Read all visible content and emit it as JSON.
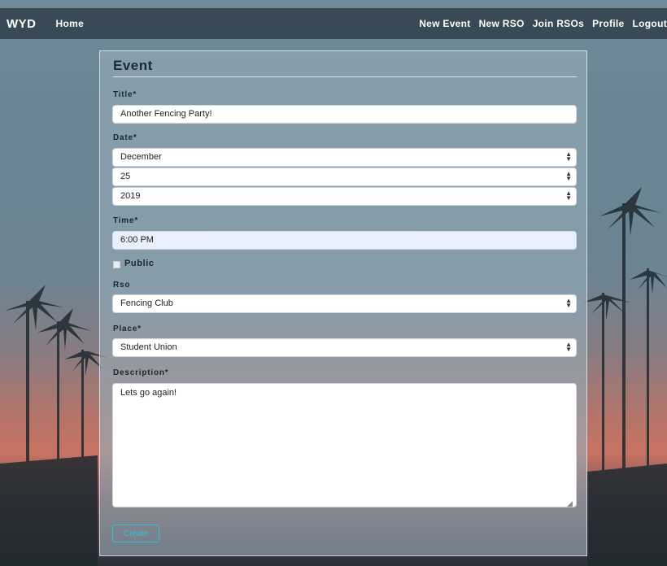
{
  "nav": {
    "brand": "WYD",
    "home": "Home",
    "links": [
      "New Event",
      "New RSO",
      "Join RSOs",
      "Profile",
      "Logout"
    ]
  },
  "form": {
    "heading": "Event",
    "title_label": "Title*",
    "title_value": "Another Fencing Party!",
    "date_label": "Date*",
    "month": "December",
    "day": "25",
    "year": "2019",
    "time_label": "Time*",
    "time_value": "6:00 PM",
    "public_label": "Public",
    "rso_label": "Rso",
    "rso_value": "Fencing Club",
    "place_label": "Place*",
    "place_value": "Student Union",
    "description_label": "Description*",
    "description_value": "Lets go again!",
    "create_label": "Create"
  },
  "colors": {
    "accent": "#2fc2d4",
    "nav_bg": "#344450"
  }
}
